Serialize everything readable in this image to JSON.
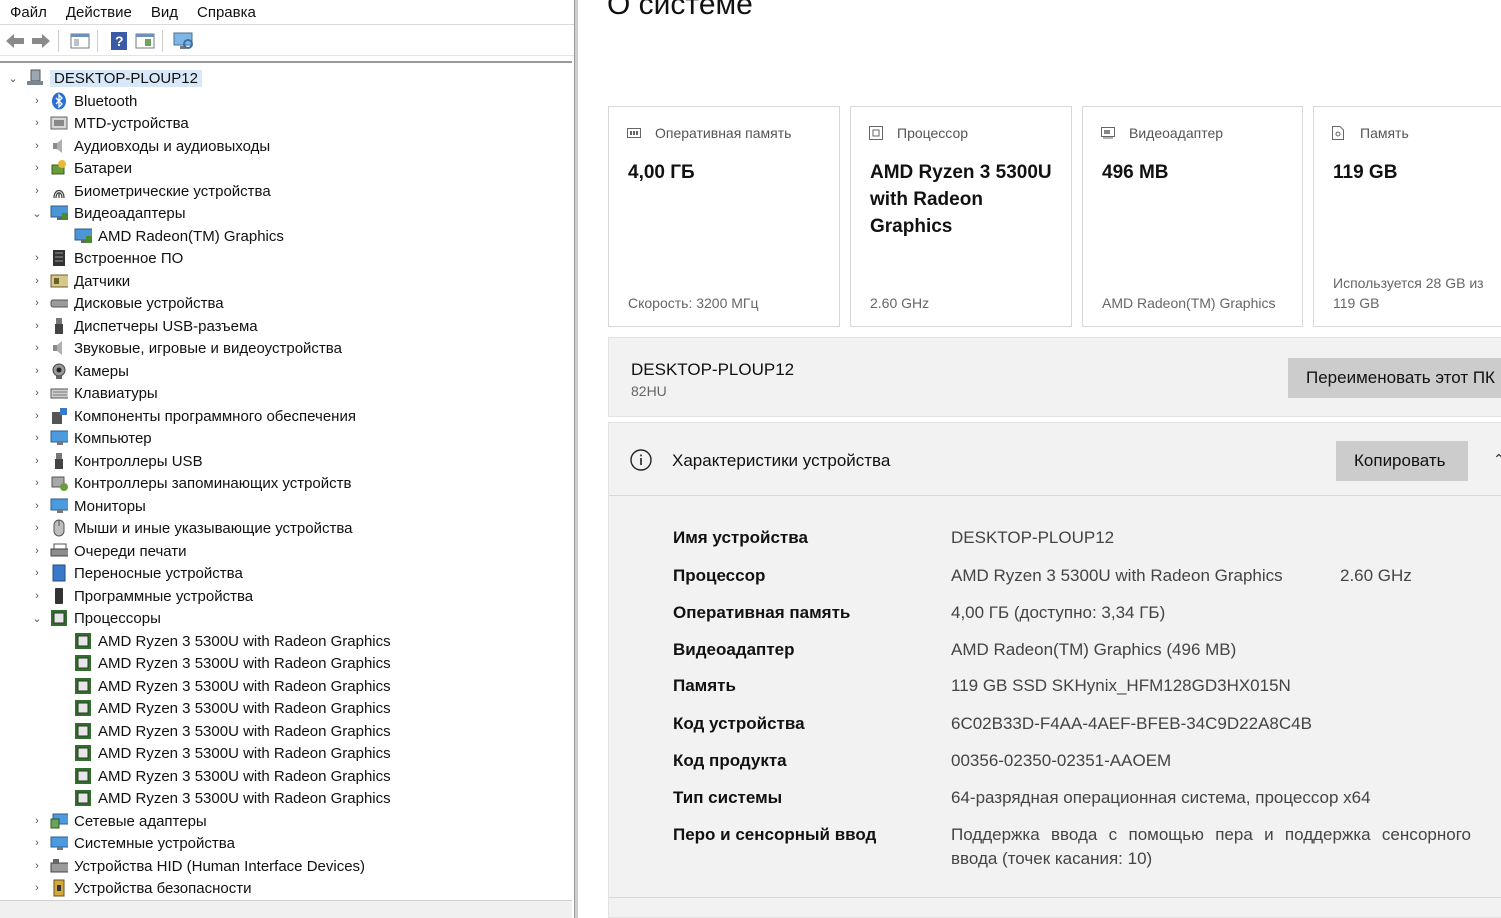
{
  "device_manager": {
    "menu": [
      "Файл",
      "Действие",
      "Вид",
      "Справка"
    ],
    "root": "DESKTOP-PLOUP12",
    "categories": [
      "Bluetooth",
      "MTD-устройства",
      "Аудиовходы и аудиовыходы",
      "Батареи",
      "Биометрические устройства",
      "Видеоадаптеры",
      "AMD Radeon(TM) Graphics",
      "Встроенное ПО",
      "Датчики",
      "Дисковые устройства",
      "Диспетчеры USB-разъема",
      "Звуковые, игровые и видеоустройства",
      "Камеры",
      "Клавиатуры",
      "Компоненты программного обеспечения",
      "Компьютер",
      "Контроллеры USB",
      "Контроллеры запоминающих устройств",
      "Мониторы",
      "Мыши и иные указывающие устройства",
      "Очереди печати",
      "Переносные устройства",
      "Программные устройства",
      "Процессоры",
      "AMD Ryzen 3 5300U with Radeon Graphics",
      "AMD Ryzen 3 5300U with Radeon Graphics",
      "AMD Ryzen 3 5300U with Radeon Graphics",
      "AMD Ryzen 3 5300U with Radeon Graphics",
      "AMD Ryzen 3 5300U with Radeon Graphics",
      "AMD Ryzen 3 5300U with Radeon Graphics",
      "AMD Ryzen 3 5300U with Radeon Graphics",
      "AMD Ryzen 3 5300U with Radeon Graphics",
      "Сетевые адаптеры",
      "Системные устройства",
      "Устройства HID (Human Interface Devices)",
      "Устройства безопасности"
    ]
  },
  "settings": {
    "title": "О системе",
    "cards": [
      {
        "label": "Оперативная память",
        "value": "4,00 ГБ",
        "footer": "Скорость: 3200 МГц",
        "icon": "ram-icon"
      },
      {
        "label": "Процессор",
        "value": "AMD Ryzen 3 5300U with Radeon Graphics",
        "footer": "2.60 GHz",
        "icon": "cpu-icon"
      },
      {
        "label": "Видеоадаптер",
        "value": "496 MB",
        "footer": "AMD Radeon(TM) Graphics",
        "icon": "gpu-icon"
      },
      {
        "label": "Память",
        "value": "119 GB",
        "footer": "Используется 28 GB из 119 GB",
        "icon": "storage-icon"
      }
    ],
    "pc_name": "DESKTOP-PLOUP12",
    "pc_model": "82HU",
    "rename_button": "Переименовать этот ПК",
    "specs_title": "Характеристики устройства",
    "copy_button": "Копировать",
    "specs": [
      {
        "key": "Имя устройства",
        "value": "DESKTOP-PLOUP12"
      },
      {
        "key": "Процессор",
        "value": "AMD Ryzen 3 5300U with Radeon Graphics",
        "value2": "2.60 GHz"
      },
      {
        "key": "Оперативная память",
        "value": "4,00 ГБ (доступно: 3,34 ГБ)"
      },
      {
        "key": "Видеоадаптер",
        "value": "AMD Radeon(TM) Graphics (496 MB)"
      },
      {
        "key": "Память",
        "value": "119 GB SSD SKHynix_HFM128GD3HX015N"
      },
      {
        "key": "Код устройства",
        "value": "6C02B33D-F4AA-4AEF-BFEB-34C9D22A8C4B"
      },
      {
        "key": "Код продукта",
        "value": "00356-02350-02351-AAOEM"
      },
      {
        "key": "Тип системы",
        "value": "64-разрядная операционная система, процессор x64"
      },
      {
        "key": "Перо и сенсорный ввод",
        "value": "Поддержка ввода с помощью пера и поддержка сенсорного ввода (точек касания: 10)"
      }
    ]
  }
}
